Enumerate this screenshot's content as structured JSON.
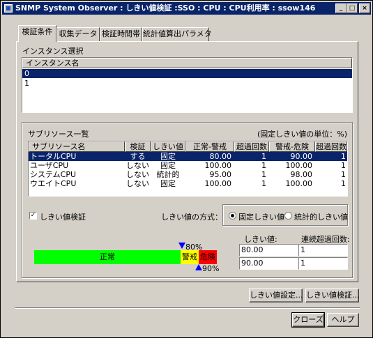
{
  "window": {
    "title": "SNMP System Observer : しきい値検証 :SSO : CPU : CPU利用率 : ssow146",
    "min_glyph": "_",
    "max_glyph": "□",
    "close_glyph": "×"
  },
  "tabs": [
    {
      "label": "検証条件"
    },
    {
      "label": "収集データ"
    },
    {
      "label": "検証時間帯"
    },
    {
      "label": "統計値算出パラメタ"
    }
  ],
  "instance": {
    "section_label": "インスタンス選択",
    "column_header": "インスタンス名",
    "items": [
      "0",
      "1"
    ]
  },
  "subresource": {
    "section_label": "サブリソース一覧",
    "unit_note": "(固定しきい値の単位：%)",
    "columns": [
      "サブリソース名",
      "検証",
      "しきい値",
      "正常-警戒",
      "超過回数",
      "警戒-危険",
      "超過回数"
    ],
    "rows": [
      [
        "トータルCPU",
        "する",
        "固定",
        "80.00",
        "1",
        "90.00",
        "1"
      ],
      [
        "ユーザCPU",
        "しない",
        "固定",
        "100.00",
        "1",
        "100.00",
        "1"
      ],
      [
        "システムCPU",
        "しない",
        "統計的",
        "95.00",
        "1",
        "98.00",
        "1"
      ],
      [
        "ウエイトCPU",
        "しない",
        "固定",
        "100.00",
        "1",
        "100.00",
        "1"
      ]
    ]
  },
  "verify_checkbox": {
    "label": "しきい値検証",
    "checked": true,
    "mark": "✓"
  },
  "method": {
    "label": "しきい値の方式：",
    "options": [
      {
        "label": "固定しきい値",
        "selected": true
      },
      {
        "label": "統計的しきい値",
        "selected": false
      }
    ]
  },
  "gauge": {
    "normal_label": "正常",
    "warning_label": "警戒",
    "danger_label": "危険",
    "upper_marker": "80%",
    "lower_marker": "90%",
    "colors": {
      "normal": "#00ff00",
      "warning": "#ffff00",
      "danger": "#ff0000",
      "marker": "#0000ff"
    }
  },
  "threshold": {
    "value_header": "しきい値:",
    "count_header": "連続超過回数:",
    "values": [
      "80.00",
      "90.00"
    ],
    "counts": [
      "1",
      "1"
    ]
  },
  "buttons": {
    "set": "しきい値設定...",
    "verify": "しきい値検証...",
    "close": "クローズ",
    "help": "ヘルプ"
  }
}
